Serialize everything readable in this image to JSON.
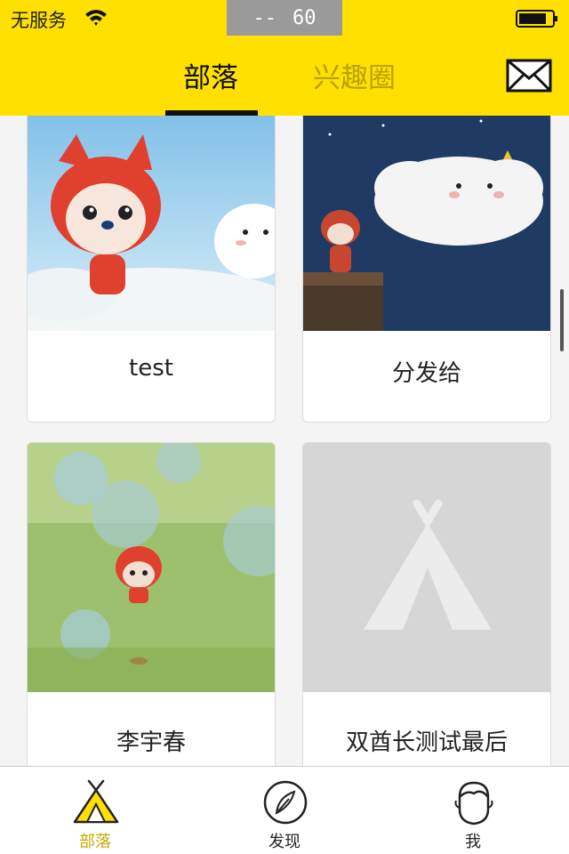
{
  "status_bar": {
    "carrier": "无服务",
    "timer_dashes": "--",
    "timer_value": "60"
  },
  "nav": {
    "tabs": [
      {
        "label": "部落",
        "active": true
      },
      {
        "label": "兴趣圈",
        "active": false
      }
    ],
    "accent_color": "#ffe000"
  },
  "cards": [
    {
      "title": "test"
    },
    {
      "title": "分发给"
    },
    {
      "title": "李宇春"
    },
    {
      "title": "双酋长测试最后"
    }
  ],
  "tab_bar": {
    "items": [
      {
        "label": "部落",
        "active": true,
        "icon": "tribe-tent-icon"
      },
      {
        "label": "发现",
        "active": false,
        "icon": "discover-feather-icon"
      },
      {
        "label": "我",
        "active": false,
        "icon": "profile-face-icon"
      }
    ],
    "active_color": "#c9a800"
  }
}
